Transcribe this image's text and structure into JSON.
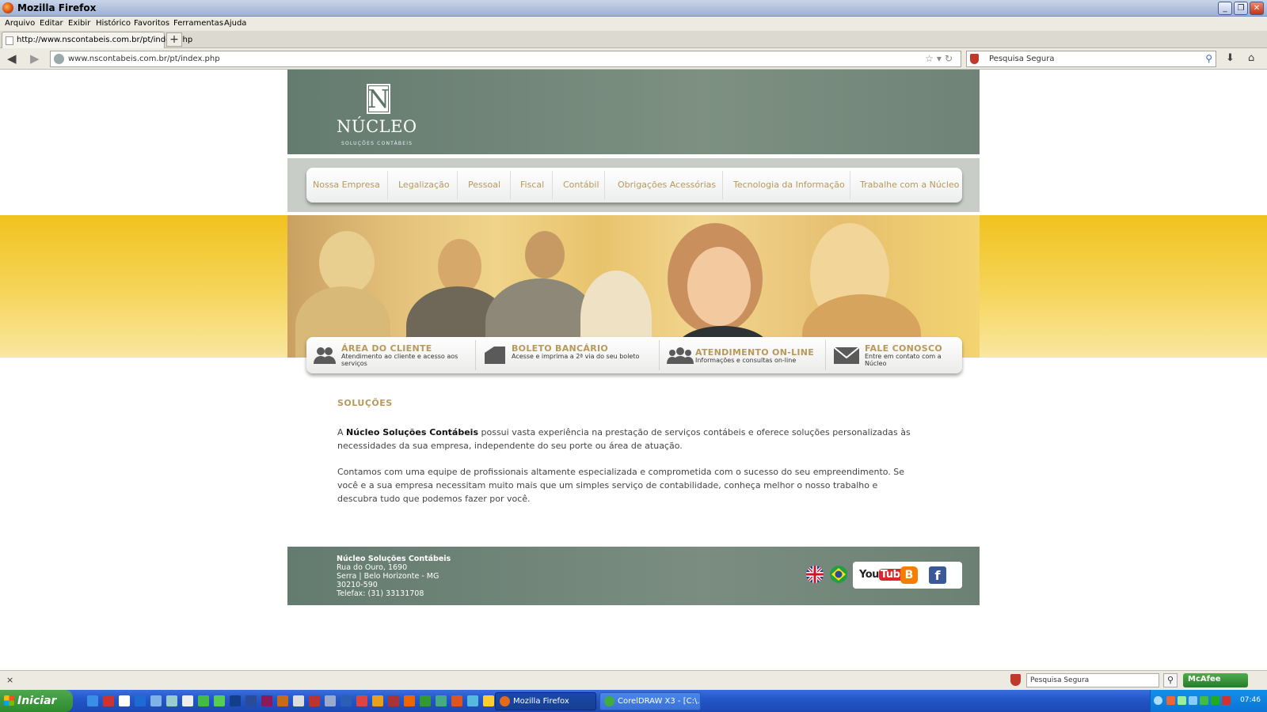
{
  "window": {
    "title": "Mozilla Firefox",
    "controls": {
      "minimize": "_",
      "restore": "❐",
      "close": "✕"
    }
  },
  "menubar": [
    "Arquivo",
    "Editar",
    "Exibir",
    "Histórico",
    "Favoritos",
    "Ferramentas",
    "Ajuda"
  ],
  "tabs": [
    {
      "label": "http://www.nscontabeis.com.br/pt/index.php"
    }
  ],
  "new_tab_label": "+",
  "navbar": {
    "url": "www.nscontabeis.com.br/pt/index.php",
    "search_placeholder": "Pesquisa Segura"
  },
  "site": {
    "logo_letter": "N",
    "logo_name": "NÚCLEO",
    "logo_tagline": "SOLUÇÕES CONTÁBEIS",
    "menu": [
      "Nossa Empresa",
      "Legalização",
      "Pessoal",
      "Fiscal",
      "Contábil",
      "Obrigações Acessórias",
      "Tecnologia da Informação",
      "Trabalhe com a Núcleo"
    ],
    "quicklinks": [
      {
        "title": "ÁREA DO CLIENTE",
        "desc": "Atendimento ao cliente e acesso aos serviços",
        "icon": "people-icon"
      },
      {
        "title": "BOLETO BANCÁRIO",
        "desc": "Acesse e imprima a 2ª via do seu boleto",
        "icon": "boleto-icon"
      },
      {
        "title": "ATENDIMENTO ON-LINE",
        "desc": "Informações e consultas on-line",
        "icon": "group-icon"
      },
      {
        "title": "FALE CONOSCO",
        "desc": "Entre em contato com a Núcleo",
        "icon": "envelope-icon"
      }
    ],
    "section_title": "SOLUÇÕES",
    "para1_prefix": "A ",
    "para1_bold": "Núcleo Soluções Contábeis",
    "para1_rest": " possui vasta experiência na prestação de serviços contábeis e oferece soluções personalizadas às necessidades da sua empresa, independente do seu porte ou área de atuação.",
    "para2": "Contamos com uma equipe de profissionais altamente especializada e comprometida com o sucesso do seu empreendimento. Se você e a sua empresa necessitam muito mais que um simples serviço de contabilidade, conheça melhor o nosso trabalho e descubra tudo que podemos fazer por você.",
    "footer": {
      "company": "Núcleo Soluções Contábeis",
      "address1": "Rua do Ouro, 1690",
      "address2": "Serra | Belo Horizonte - MG",
      "zip": "30210-590",
      "phone": "Telefax: (31) 33131708"
    },
    "social": {
      "youtube_you": "You",
      "youtube_tube": "Tube",
      "blogger": "B",
      "facebook": "f"
    }
  },
  "statusbar": {
    "close": "×",
    "search_placeholder": "Pesquisa Segura",
    "mcafee": "McAfee"
  },
  "taskbar": {
    "start": "Iniciar",
    "windows": [
      "Mozilla Firefox",
      "CorelDRAW X3 - [C:\\..."
    ],
    "clock": "07:46"
  },
  "colors": {
    "accent_gold": "#b8995a",
    "header_green": "#6f8477",
    "banner_yellow": "#f1c21e"
  }
}
